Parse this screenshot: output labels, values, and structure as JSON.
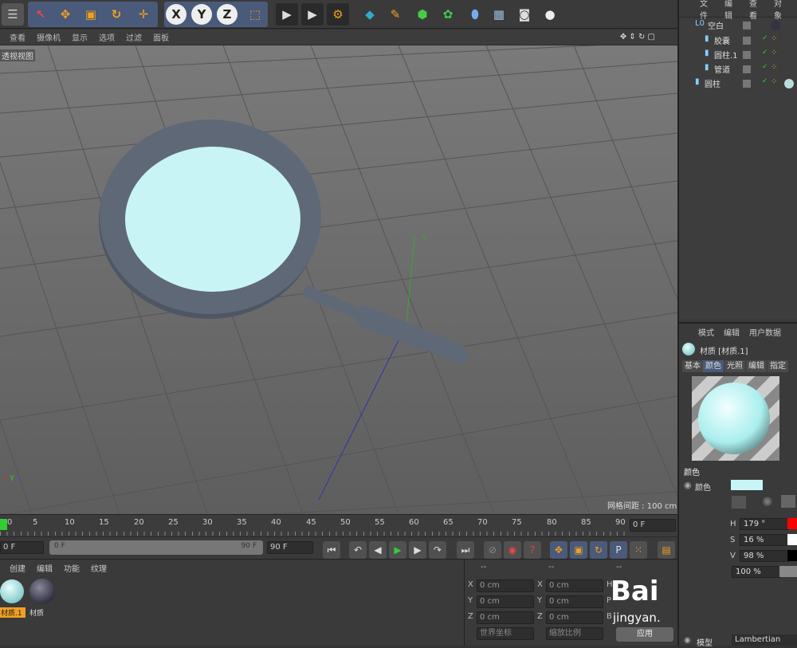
{
  "toolbar": {
    "axis_x": "X",
    "axis_y": "Y",
    "axis_z": "Z"
  },
  "viewport": {
    "menu": [
      "查看",
      "摄像机",
      "显示",
      "选项",
      "过滤",
      "面板"
    ],
    "label": "透视视图",
    "grid_info": "网格间距 : 100 cm",
    "axis_x": "x",
    "axis_y": "Y",
    "axis_z": "z"
  },
  "timeline": {
    "ticks": [
      "0",
      "5",
      "10",
      "15",
      "20",
      "25",
      "30",
      "35",
      "40",
      "45",
      "50",
      "55",
      "60",
      "65",
      "70",
      "75",
      "80",
      "85",
      "90"
    ],
    "current": "0 F",
    "start": "0 F",
    "range_start": "0 F",
    "range_end": "90 F",
    "end": "90 F"
  },
  "material_manager": {
    "menu": [
      "创建",
      "编辑",
      "功能",
      "纹理"
    ],
    "materials": [
      {
        "name": "材质.1",
        "selected": true
      },
      {
        "name": "材质",
        "selected": false
      }
    ]
  },
  "coordinates": {
    "header1": "--",
    "header2": "--",
    "header3": "--",
    "rows": [
      {
        "l1": "X",
        "v1": "0 cm",
        "l2": "X",
        "v2": "0 cm",
        "l3": "H"
      },
      {
        "l1": "Y",
        "v1": "0 cm",
        "l2": "Y",
        "v2": "0 cm",
        "l3": "P"
      },
      {
        "l1": "Z",
        "v1": "0 cm",
        "l2": "Z",
        "v2": "0 cm",
        "l3": "B"
      }
    ],
    "mode1": "世界坐标",
    "mode2": "缩放比例",
    "apply": "应用"
  },
  "object_manager": {
    "menu": [
      "文件",
      "编辑",
      "查看",
      "对象"
    ],
    "objects": [
      {
        "name": "空白",
        "indent": 0
      },
      {
        "name": "胶囊",
        "indent": 1
      },
      {
        "name": "圆柱.1",
        "indent": 1
      },
      {
        "name": "管道",
        "indent": 1
      },
      {
        "name": "圆柱",
        "indent": 0
      }
    ]
  },
  "attributes": {
    "menu": [
      "模式",
      "编辑",
      "用户数据"
    ],
    "title": "材质 [材质.1]",
    "tabs": [
      "基本",
      "颜色",
      "光照",
      "编辑",
      "指定"
    ],
    "active_tab": "颜色",
    "section": "颜色",
    "color_label": "颜色",
    "swatch": "#c8f4f6",
    "h_label": "H",
    "h": "179 °",
    "s_label": "S",
    "s": "16 %",
    "v_label": "V",
    "v": "98 %",
    "brightness": "100 %",
    "bottom_label": "模型",
    "shader": "Lambertian"
  },
  "watermark": {
    "line1": "Bai",
    "line2": "jingyan."
  },
  "colors": {
    "accent": "#f0a020",
    "object": "#5f6876",
    "lens": "#c8f4f6",
    "viewport": "#6a6a6a"
  }
}
